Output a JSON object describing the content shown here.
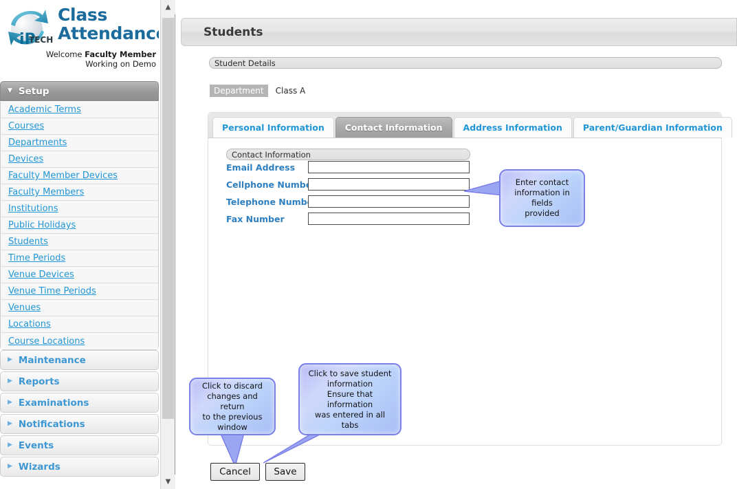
{
  "brand": {
    "logo_icon": "iptech-globe-logo",
    "title_line1": "Class",
    "title_line2": "Attendance",
    "welcome_prefix": "Welcome ",
    "welcome_name": "Faculty Member",
    "working_on": "Working on Demo"
  },
  "sidebar": {
    "groups": [
      {
        "label": "Setup",
        "state": "expanded",
        "icon": "chevron-down-icon",
        "items": [
          {
            "label": "Academic Terms"
          },
          {
            "label": "Courses"
          },
          {
            "label": "Departments"
          },
          {
            "label": "Devices"
          },
          {
            "label": "Faculty Member Devices"
          },
          {
            "label": "Faculty Members"
          },
          {
            "label": "Institutions"
          },
          {
            "label": "Public Holidays"
          },
          {
            "label": "Students"
          },
          {
            "label": "Time Periods"
          },
          {
            "label": "Venue Devices"
          },
          {
            "label": "Venue Time Periods"
          },
          {
            "label": "Venues"
          },
          {
            "label": "Locations"
          },
          {
            "label": "Course Locations"
          }
        ]
      },
      {
        "label": "Maintenance",
        "state": "collapsed",
        "icon": "chevron-right-icon",
        "items": []
      },
      {
        "label": "Reports",
        "state": "collapsed",
        "icon": "chevron-right-icon",
        "items": []
      },
      {
        "label": "Examinations",
        "state": "collapsed",
        "icon": "chevron-right-icon",
        "items": []
      },
      {
        "label": "Notifications",
        "state": "collapsed",
        "icon": "chevron-right-icon",
        "items": []
      },
      {
        "label": "Events",
        "state": "collapsed",
        "icon": "chevron-right-icon",
        "items": []
      },
      {
        "label": "Wizards",
        "state": "collapsed",
        "icon": "chevron-right-icon",
        "items": []
      }
    ]
  },
  "scrollbar": {
    "up_icon": "chevron-up-icon",
    "down_icon": "chevron-down-icon"
  },
  "main": {
    "page_title": "Students",
    "section_bar": "Student Details",
    "department": {
      "label": "Department",
      "value": "Class A"
    },
    "tabs": [
      {
        "label": "Personal Information",
        "active": false
      },
      {
        "label": "Contact Information",
        "active": true
      },
      {
        "label": "Address Information",
        "active": false
      },
      {
        "label": "Parent/Guardian Information",
        "active": false
      }
    ],
    "form": {
      "group_title": "Contact Information",
      "fields": [
        {
          "label": "Email Address",
          "value": "",
          "placeholder": ""
        },
        {
          "label": "Cellphone Number",
          "value": "",
          "placeholder": ""
        },
        {
          "label": "Telephone Number",
          "value": "",
          "placeholder": ""
        },
        {
          "label": "Fax Number",
          "value": "",
          "placeholder": ""
        }
      ]
    },
    "buttons": {
      "cancel": "Cancel",
      "save": "Save"
    }
  },
  "callouts": {
    "contact": "Enter contact\ninformation in fields\nprovided",
    "cancel": "Click to discard\nchanges and return\nto the previous\nwindow",
    "save": "Click to save student\ninformation\nEnsure that information\nwas entered in all tabs"
  },
  "colors": {
    "brand_blue": "#1b6c9c",
    "link_blue": "#2196d6",
    "field_label_blue": "#2d7fc0",
    "callout_border": "#7b7fe8",
    "callout_fill": "#bcd4fb"
  }
}
